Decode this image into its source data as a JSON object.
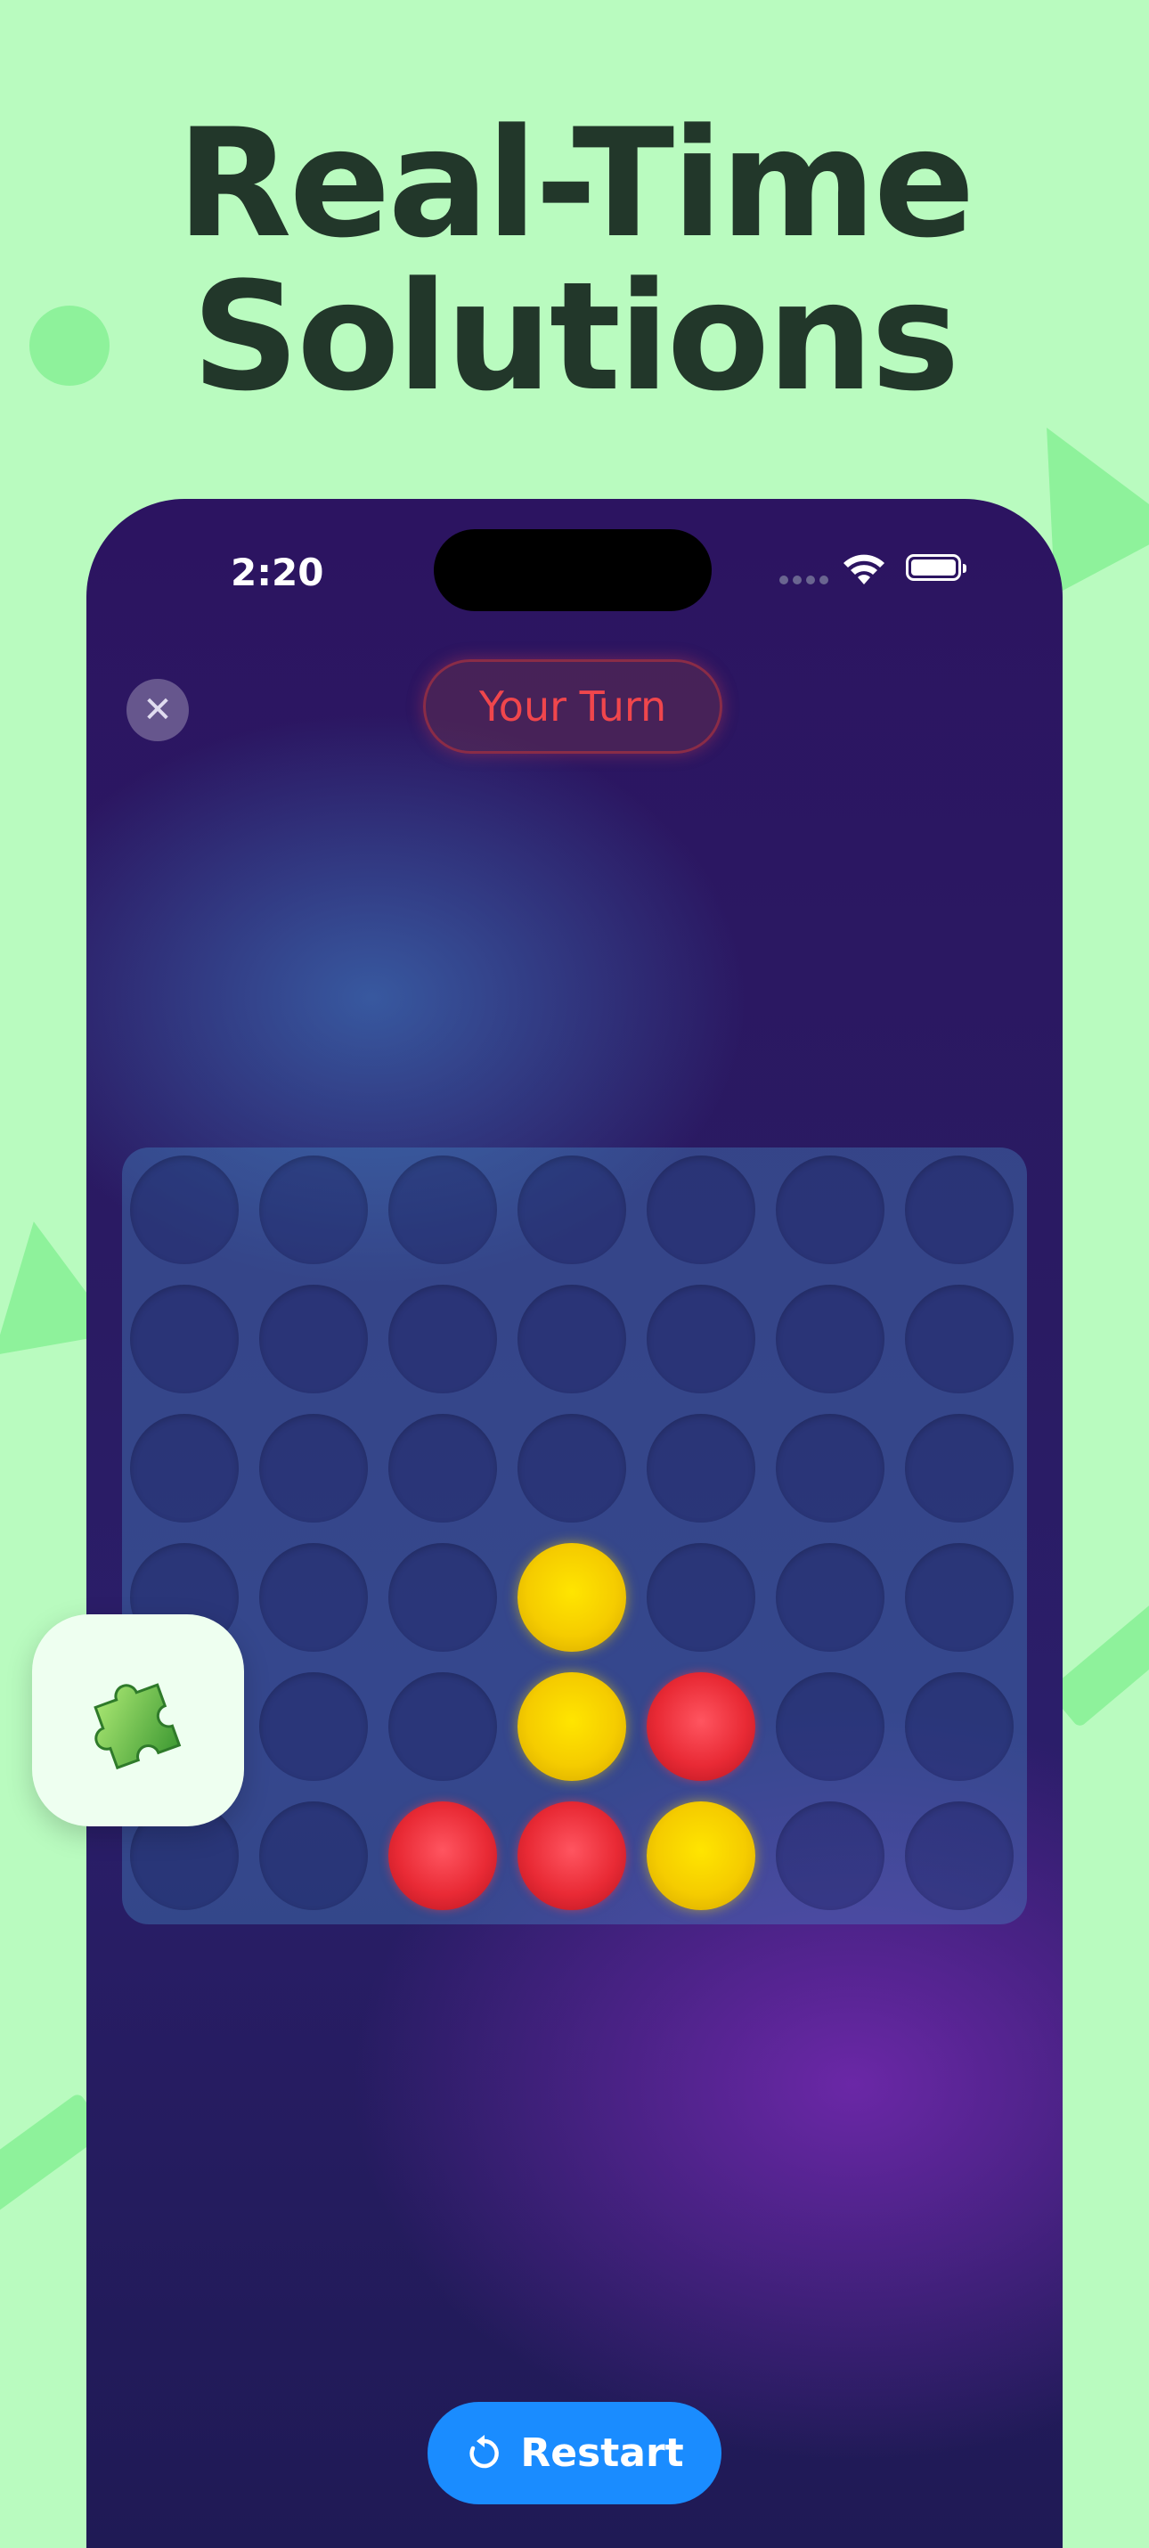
{
  "headline": {
    "line1": "Real-Time",
    "line2": "Solutions"
  },
  "status_bar": {
    "time": "2:20"
  },
  "game": {
    "turn_label": "Your Turn",
    "close_icon": "close-icon",
    "board": {
      "rows": 6,
      "cols": 7,
      "pieces": [
        [
          "",
          "",
          "",
          "",
          "",
          "",
          ""
        ],
        [
          "",
          "",
          "",
          "",
          "",
          "",
          ""
        ],
        [
          "",
          "",
          "",
          "",
          "",
          "",
          ""
        ],
        [
          "",
          "",
          "",
          "yellow",
          "",
          "",
          ""
        ],
        [
          "",
          "",
          "",
          "yellow",
          "red",
          "",
          ""
        ],
        [
          "",
          "",
          "red",
          "red",
          "yellow",
          "",
          ""
        ]
      ]
    },
    "restart_label": "Restart",
    "restart_icon": "restart-icon"
  },
  "app_icon": "puzzle-piece-icon",
  "colors": {
    "background": "#b9fbbf",
    "headline": "#22372a",
    "turn_text": "#f0464c",
    "restart_button": "#1a8cff",
    "red_piece": "#e92a35",
    "yellow_piece": "#f5cc00"
  }
}
